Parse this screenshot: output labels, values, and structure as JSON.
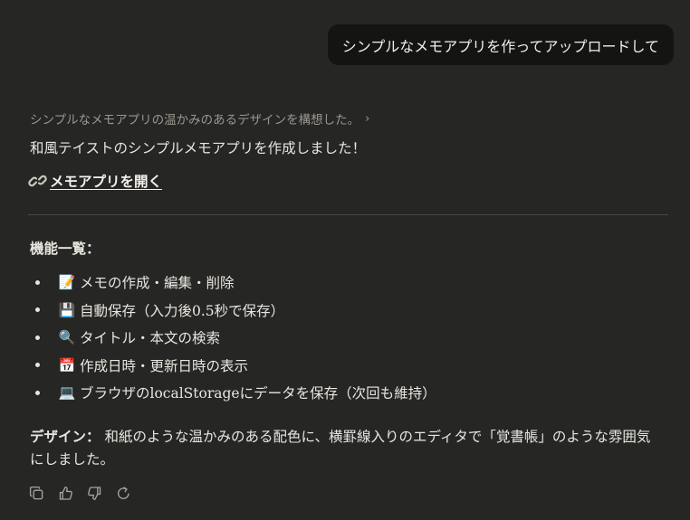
{
  "user_message": "シンプルなメモアプリを作ってアップロードして",
  "thinking_summary": "シンプルなメモアプリの温かみのあるデザインを構想した。",
  "thinking_chevron": "›",
  "response": {
    "intro": "和風テイストのシンプルメモアプリを作成しました！",
    "link_label": "メモアプリを開く",
    "link_icon": "link-icon",
    "features_heading": "機能一覧：",
    "features": [
      {
        "icon": "memo-icon",
        "glyph": "📝",
        "text": "メモの作成・編集・削除"
      },
      {
        "icon": "floppy-disk-icon",
        "glyph": "💾",
        "text": "自動保存（入力後0.5秒で保存）"
      },
      {
        "icon": "magnifier-icon",
        "glyph": "🔍",
        "text": "タイトル・本文の検索"
      },
      {
        "icon": "calendar-icon",
        "glyph": "📅",
        "text": "作成日時・更新日時の表示"
      },
      {
        "icon": "laptop-icon",
        "glyph": "💻",
        "text": "ブラウザのlocalStorageにデータを保存（次回も維持）"
      }
    ],
    "design_label": "デザイン：",
    "design_text": "和紙のような温かみのある配色に、横罫線入りのエディタで「覚書帳」のような雰囲気にしました。"
  },
  "actions": [
    "copy-icon",
    "thumbs-up-icon",
    "thumbs-down-icon",
    "retry-icon"
  ],
  "colors": {
    "background": "#262624",
    "user_bubble": "#141413",
    "text": "#e9e6df",
    "muted_text": "#9b978f",
    "divider": "#4a4844"
  }
}
